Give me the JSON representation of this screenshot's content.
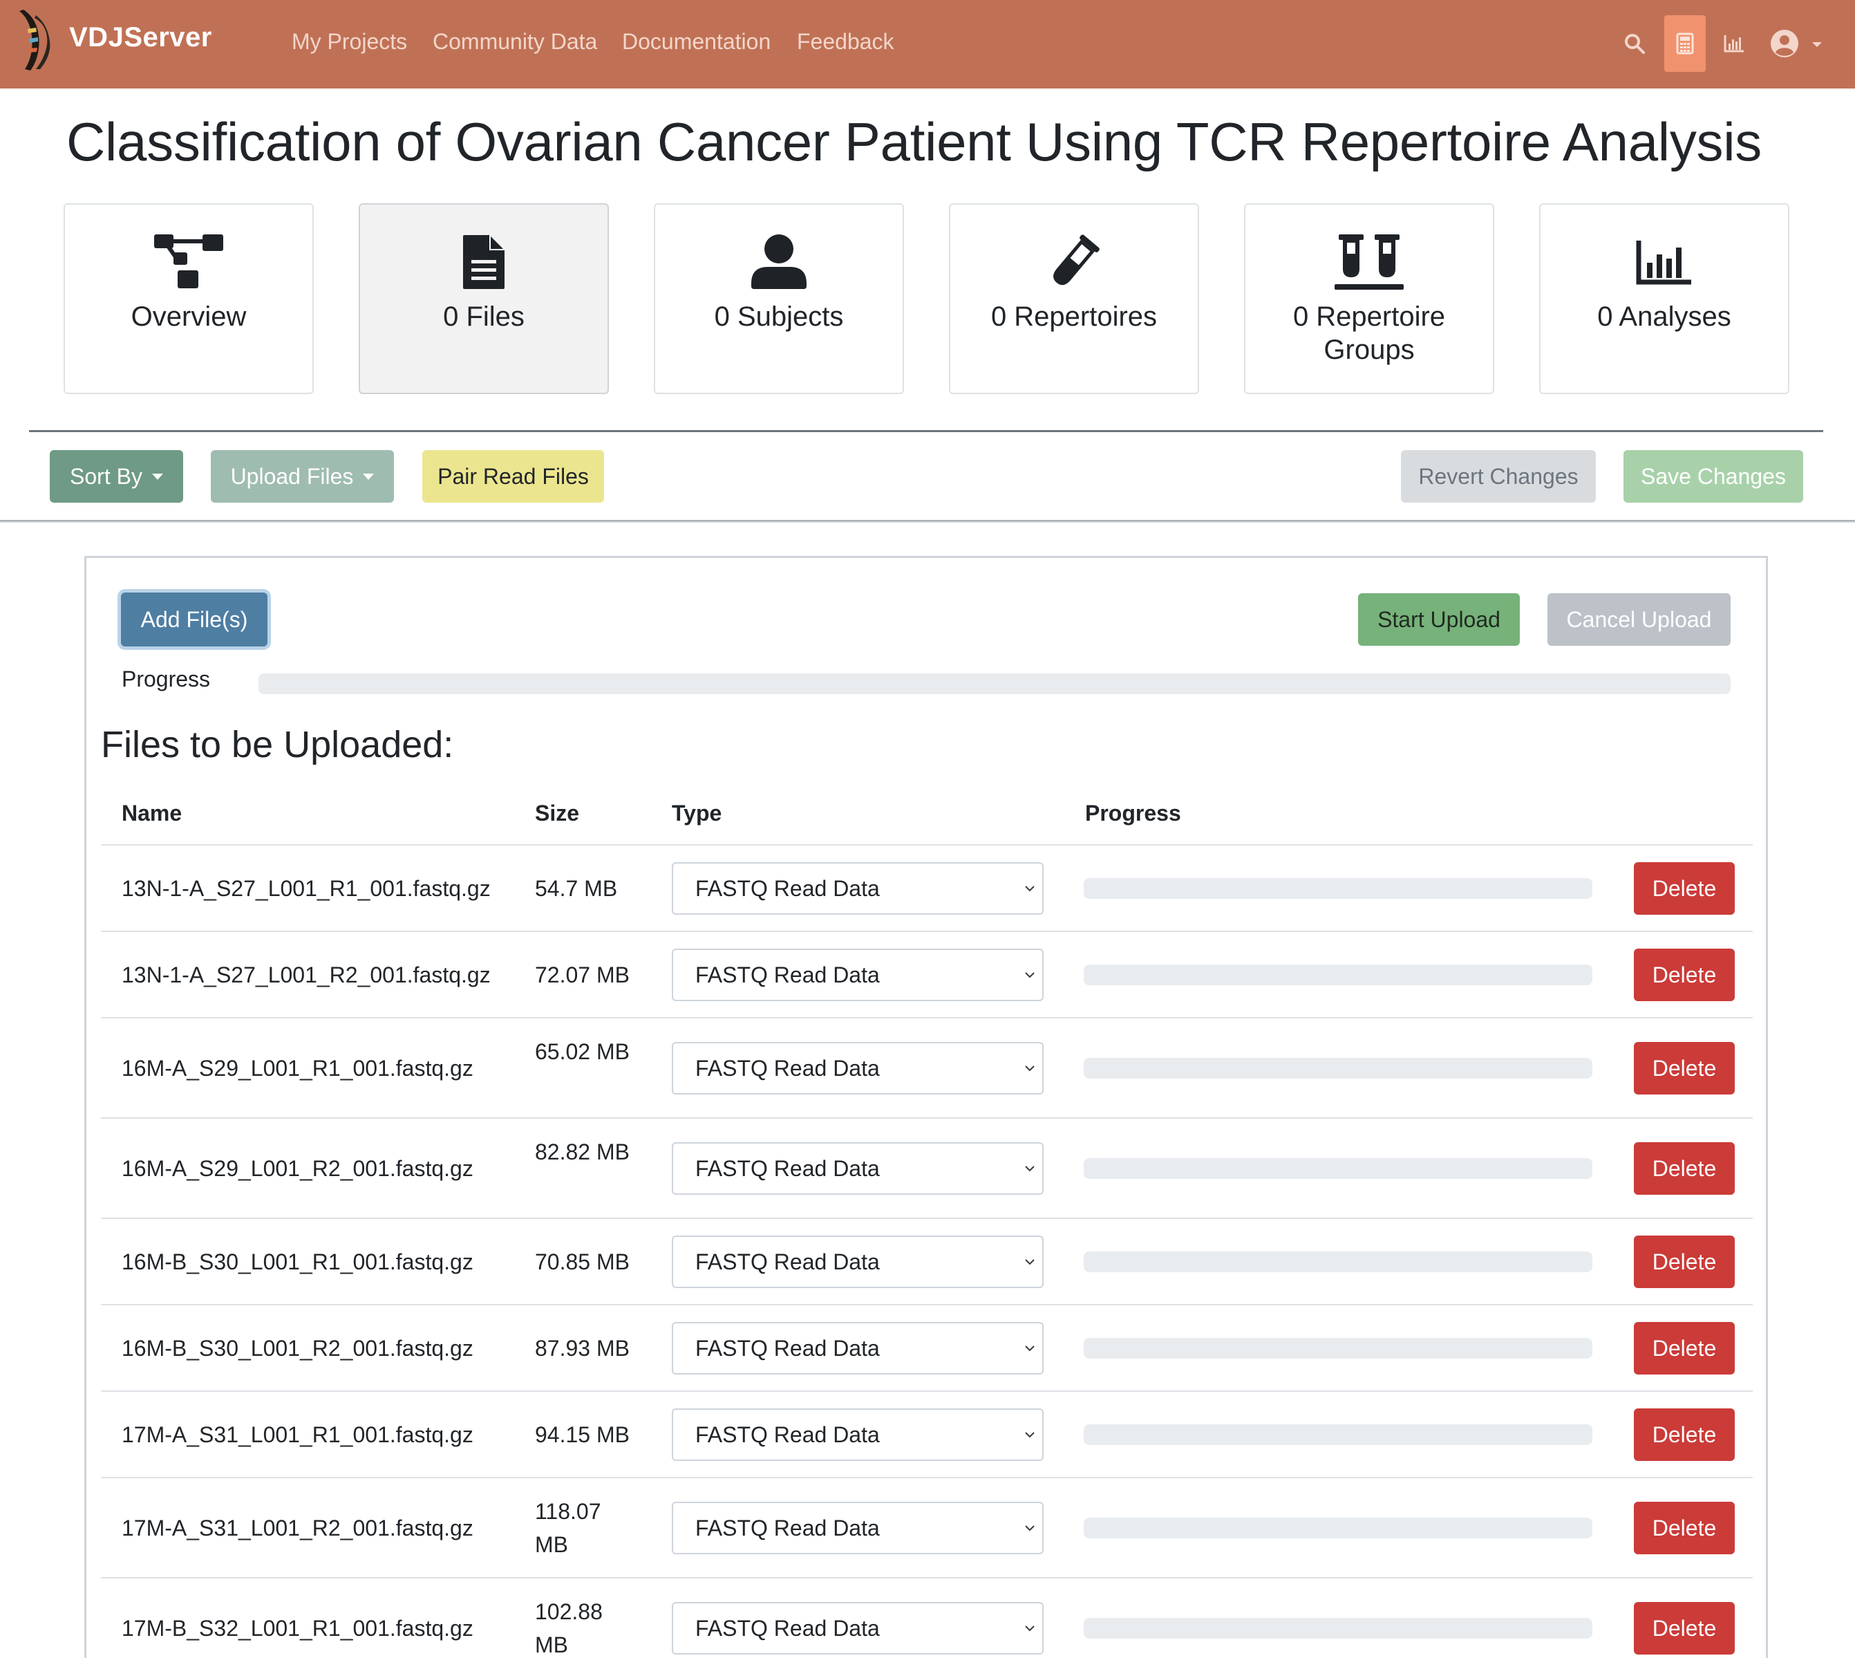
{
  "navbar": {
    "brand": "VDJServer",
    "links": [
      "My Projects",
      "Community Data",
      "Documentation",
      "Feedback"
    ],
    "icons": [
      "search-icon",
      "calculator-icon",
      "chart-icon",
      "user-circle-icon"
    ]
  },
  "project": {
    "title": "Classification of Ovarian Cancer Patient Using TCR Repertoire Analysis"
  },
  "cards": [
    {
      "label": "Overview",
      "icon": "overview-icon"
    },
    {
      "label": "0 Files",
      "icon": "file-icon",
      "active": true
    },
    {
      "label": "0 Subjects",
      "icon": "person-icon"
    },
    {
      "label": "0 Repertoires",
      "icon": "test-tube-icon"
    },
    {
      "label": "0 Repertoire Groups",
      "icon": "test-tubes-icon"
    },
    {
      "label": "0 Analyses",
      "icon": "bar-chart-icon"
    }
  ],
  "toolbar": {
    "sort_by": "Sort By",
    "upload_files": "Upload Files",
    "pair_read_files": "Pair Read Files",
    "revert_changes": "Revert Changes",
    "save_changes": "Save Changes"
  },
  "upload": {
    "add_files": "Add File(s)",
    "start_upload": "Start Upload",
    "cancel_upload": "Cancel Upload",
    "progress_label": "Progress",
    "overall_progress": 0,
    "section_title": "Files to be Uploaded:",
    "columns": [
      "Name",
      "Size",
      "Type",
      "Progress"
    ],
    "files": [
      {
        "name": "13N-1-A_S27_L001_R1_001.fastq.gz",
        "size": "54.7 MB",
        "type": "FASTQ Read Data",
        "progress": 0,
        "action": "Delete"
      },
      {
        "name": "13N-1-A_S27_L001_R2_001.fastq.gz",
        "size": "72.07 MB",
        "type": "FASTQ Read Data",
        "progress": 0,
        "action": "Delete"
      },
      {
        "name": "16M-A_S29_L001_R1_001.fastq.gz",
        "size": "65.02 MB",
        "type": "FASTQ Read Data",
        "progress": 0,
        "action": "Delete"
      },
      {
        "name": "16M-A_S29_L001_R2_001.fastq.gz",
        "size": "82.82 MB",
        "type": "FASTQ Read Data",
        "progress": 0,
        "action": "Delete"
      },
      {
        "name": "16M-B_S30_L001_R1_001.fastq.gz",
        "size": "70.85 MB",
        "type": "FASTQ Read Data",
        "progress": 0,
        "action": "Delete"
      },
      {
        "name": "16M-B_S30_L001_R2_001.fastq.gz",
        "size": "87.93 MB",
        "type": "FASTQ Read Data",
        "progress": 0,
        "action": "Delete"
      },
      {
        "name": "17M-A_S31_L001_R1_001.fastq.gz",
        "size": "94.15 MB",
        "type": "FASTQ Read Data",
        "progress": 0,
        "action": "Delete"
      },
      {
        "name": "17M-A_S31_L001_R2_001.fastq.gz",
        "size": "118.07 MB",
        "type": "FASTQ Read Data",
        "progress": 0,
        "action": "Delete"
      },
      {
        "name": "17M-B_S32_L001_R1_001.fastq.gz",
        "size": "102.88 MB",
        "type": "FASTQ Read Data",
        "progress": 0,
        "action": "Delete"
      }
    ]
  },
  "colors": {
    "navbar": "#c07155",
    "sort_button": "#6f9a85",
    "upload_button": "#9fbcb0",
    "pair_button": "#ece58f",
    "revert_button": "#d9dcdf",
    "save_button": "#a8d1aa",
    "add_files_button": "#4f7ea3",
    "start_button": "#76b27a",
    "cancel_button": "#bcc2c8",
    "delete_button": "#cb3b38"
  }
}
